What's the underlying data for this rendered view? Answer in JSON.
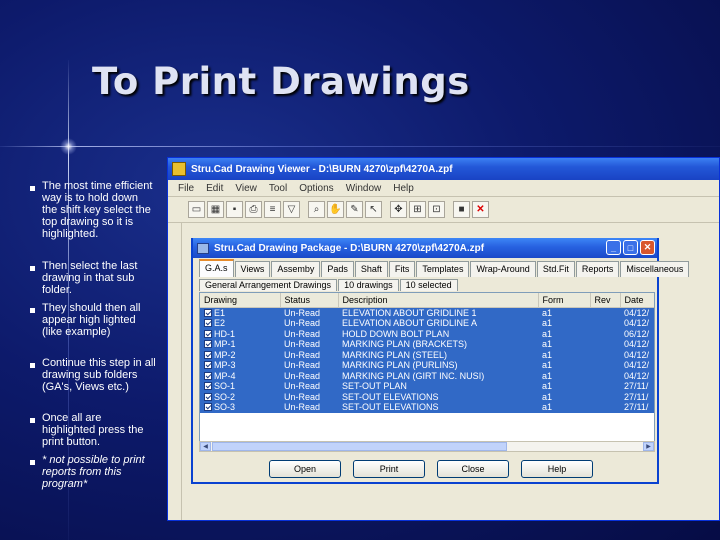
{
  "slide": {
    "title": "To Print Drawings",
    "bullets": [
      "The most time efficient way is to hold down the shift key select the top drawing so it is highlighted.",
      "Then select the last drawing in that sub folder.",
      "They should then all appear high lighted (like example)",
      "Continue this step in all drawing sub folders (GA's, Views etc.)",
      "Once all are highlighted press the print button.",
      "* not possible to print reports from this program*"
    ]
  },
  "app": {
    "title": "Stru.Cad Drawing Viewer - D:\\BURN 4270\\zpf\\4270A.zpf",
    "menu": [
      "File",
      "Edit",
      "View",
      "Tool",
      "Options",
      "Window",
      "Help"
    ]
  },
  "dialog": {
    "title": "Stru.Cad Drawing Package - D:\\BURN 4270\\zpf\\4270A.zpf",
    "tabs": [
      "G.A.s",
      "Views",
      "Assemby",
      "Pads",
      "Shaft",
      "Fits",
      "Templates",
      "Wrap-Around",
      "Std.Fit",
      "Reports",
      "Miscellaneous"
    ],
    "subtabs": [
      "General Arrangement Drawings",
      "10 drawings",
      "10 selected"
    ],
    "columns": [
      "Drawing",
      "Status",
      "Description",
      "Form",
      "Rev",
      "Date"
    ],
    "rows": [
      {
        "drawing": "E1",
        "status": "Un-Read",
        "description": "ELEVATION ABOUT GRIDLINE 1",
        "form": "a1",
        "rev": "",
        "date": "04/12/"
      },
      {
        "drawing": "E2",
        "status": "Un-Read",
        "description": "ELEVATION ABOUT GRIDLINE A",
        "form": "a1",
        "rev": "",
        "date": "04/12/"
      },
      {
        "drawing": "HD-1",
        "status": "Un-Read",
        "description": "HOLD DOWN BOLT PLAN",
        "form": "a1",
        "rev": "",
        "date": "06/12/"
      },
      {
        "drawing": "MP-1",
        "status": "Un-Read",
        "description": "MARKING PLAN (BRACKETS)",
        "form": "a1",
        "rev": "",
        "date": "04/12/"
      },
      {
        "drawing": "MP-2",
        "status": "Un-Read",
        "description": "MARKING PLAN (STEEL)",
        "form": "a1",
        "rev": "",
        "date": "04/12/"
      },
      {
        "drawing": "MP-3",
        "status": "Un-Read",
        "description": "MARKING PLAN (PURLINS)",
        "form": "a1",
        "rev": "",
        "date": "04/12/"
      },
      {
        "drawing": "MP-4",
        "status": "Un-Read",
        "description": "MARKING PLAN (GIRT INC. NUSI)",
        "form": "a1",
        "rev": "",
        "date": "04/12/"
      },
      {
        "drawing": "SO-1",
        "status": "Un-Read",
        "description": "SET-OUT PLAN",
        "form": "a1",
        "rev": "",
        "date": "27/11/"
      },
      {
        "drawing": "SO-2",
        "status": "Un-Read",
        "description": "SET-OUT ELEVATIONS",
        "form": "a1",
        "rev": "",
        "date": "27/11/"
      },
      {
        "drawing": "SO-3",
        "status": "Un-Read",
        "description": "SET-OUT ELEVATIONS",
        "form": "a1",
        "rev": "",
        "date": "27/11/"
      }
    ],
    "buttons": {
      "open": "Open",
      "print": "Print",
      "close": "Close",
      "help": "Help"
    }
  },
  "colors": {
    "selection": "#3169c6",
    "titlebar": "#2358d8",
    "slide_bg": "#0d1a6b"
  }
}
